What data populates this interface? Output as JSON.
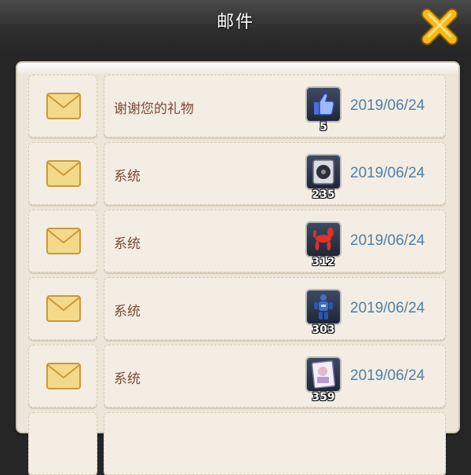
{
  "header": {
    "title": "邮件"
  },
  "close_icon": "close-x-icon",
  "colors": {
    "subject": "#7b4a3a",
    "date": "#4f7fa8",
    "panel": "#ece5d9",
    "header": "#2f2f2f"
  },
  "mails": [
    {
      "subject": "谢谢您的礼物",
      "item_icon": "thumbs-up-icon",
      "count": "5",
      "date": "2019/06/24"
    },
    {
      "subject": "系统",
      "item_icon": "speaker-icon",
      "count": "235",
      "date": "2019/06/24"
    },
    {
      "subject": "系统",
      "item_icon": "balloon-dog-icon",
      "count": "312",
      "date": "2019/06/24"
    },
    {
      "subject": "系统",
      "item_icon": "robot-figure-icon",
      "count": "303",
      "date": "2019/06/24"
    },
    {
      "subject": "系统",
      "item_icon": "card-picture-icon",
      "count": "359",
      "date": "2019/06/24"
    }
  ]
}
